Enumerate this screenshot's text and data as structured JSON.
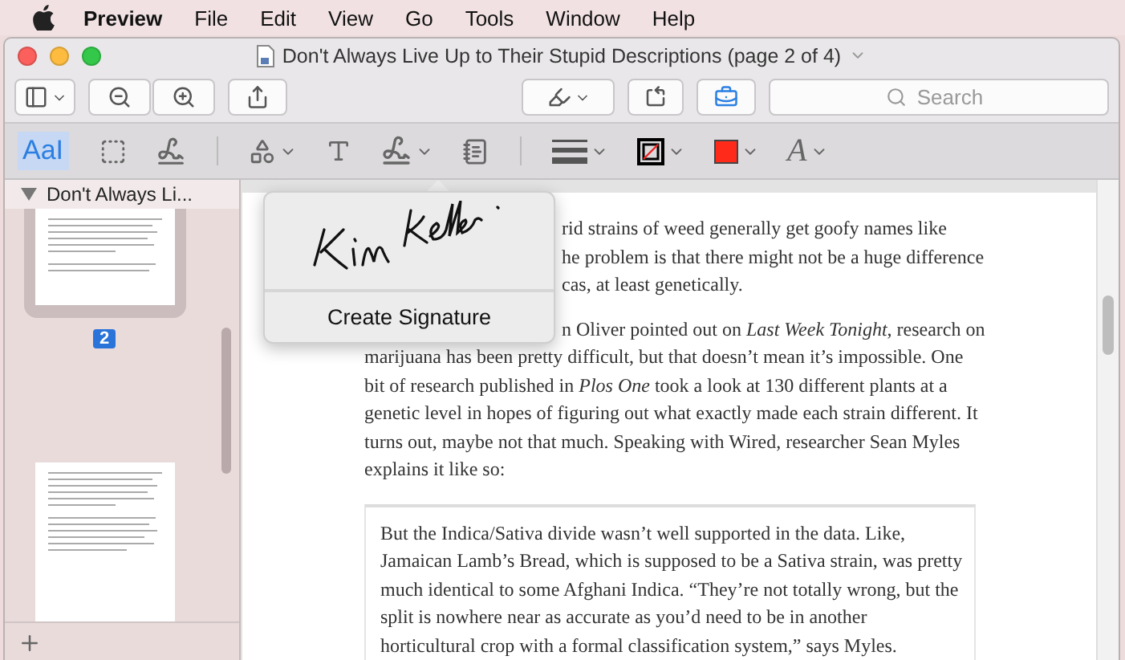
{
  "menu_bar": {
    "app_name": "Preview",
    "items": [
      "File",
      "Edit",
      "View",
      "Go",
      "Tools",
      "Window",
      "Help"
    ]
  },
  "window": {
    "title": "Don't Always Live Up to Their Stupid Descriptions (page 2 of 4)"
  },
  "toolbar": {
    "markup_active": true,
    "search_placeholder": "Search"
  },
  "markup_tools": [
    {
      "kind": "text-select",
      "label": "AaI",
      "selected": true
    },
    {
      "kind": "rect-select",
      "selected": false
    },
    {
      "kind": "sketch",
      "selected": false
    },
    {
      "kind": "divider"
    },
    {
      "kind": "shapes",
      "selected": false
    },
    {
      "kind": "text",
      "selected": false
    },
    {
      "kind": "sign",
      "selected": false
    },
    {
      "kind": "note",
      "selected": false
    },
    {
      "kind": "divider"
    },
    {
      "kind": "lines",
      "selected": false
    },
    {
      "kind": "border",
      "selected": false,
      "color": "#000000"
    },
    {
      "kind": "fill",
      "selected": false,
      "color": "#ff2a1a"
    },
    {
      "kind": "font",
      "label": "A",
      "selected": false
    }
  ],
  "signature_menu": {
    "open": true,
    "action": "Create Signature"
  },
  "sidebar": {
    "title": "Don't Always Li...",
    "expanded": true,
    "pages": [
      {
        "label": "2",
        "selected": true
      },
      {
        "selected": false
      }
    ]
  },
  "article": {
    "paragraphs": [
      {
        "lines": [
          {
            "text": "rid strains of weed generally get goofy names like",
            "covered": true
          },
          {
            "text": "he problem is that there might not be a huge difference",
            "covered": true
          },
          {
            "text": "cas, at least genetically.",
            "covered": true
          }
        ]
      },
      {
        "lines": [
          {
            "text": "n Oliver pointed out on *Last Week Tonight*, research on",
            "covered": true
          },
          {
            "text": "marijuana has been pretty difficult, but that doesn’t mean it’s impossible. One"
          },
          {
            "text": "bit of research published in *Plos One* took a look at 130 different plants at a"
          },
          {
            "text": "genetic level in hopes of figuring out what exactly made each strain different. It"
          },
          {
            "text": "turns out, maybe not that much. Speaking with Wired, researcher Sean Myles"
          },
          {
            "text": "explains it like so:"
          }
        ]
      }
    ],
    "quote": [
      "But the Indica/Sativa divide wasn’t well supported in the data. Like,",
      "Jamaican Lamb’s Bread, which is supposed to be a Sativa strain, was pretty",
      "much identical to some Afghani Indica. “They’re not totally wrong, but the",
      "split is nowhere near as accurate as you’d need to be in another",
      "horticultural crop with a formal classification system,” says Myles."
    ]
  }
}
